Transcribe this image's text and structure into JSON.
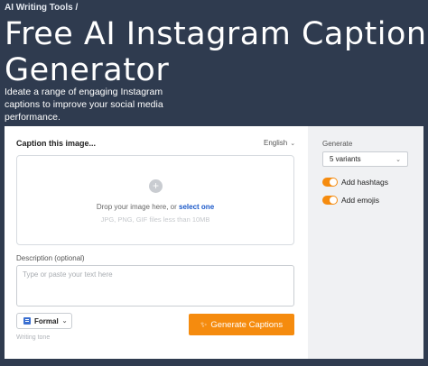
{
  "breadcrumb": "AI Writing Tools /",
  "title": "Free AI Instagram Caption Generator",
  "subtitle": "Ideate a range of engaging Instagram captions to improve your social media performance.",
  "form": {
    "caption_label": "Caption this image...",
    "language": "English",
    "dropzone": {
      "text": "Drop your image here, or",
      "link": "select one",
      "hint": "JPG, PNG, GIF files less than 10MB"
    },
    "description_label": "Description (optional)",
    "description_placeholder": "Type or paste your text here",
    "tone": "Formal",
    "tone_hint": "Writing tone",
    "generate_button": "Generate Captions"
  },
  "sidebar": {
    "generate_label": "Generate",
    "variants": "5 variants",
    "toggles": [
      {
        "label": "Add hashtags",
        "on": true
      },
      {
        "label": "Add emojis",
        "on": true
      }
    ]
  },
  "colors": {
    "background": "#2f3b4f",
    "accent": "#f58b0e",
    "link": "#1a58c9"
  }
}
